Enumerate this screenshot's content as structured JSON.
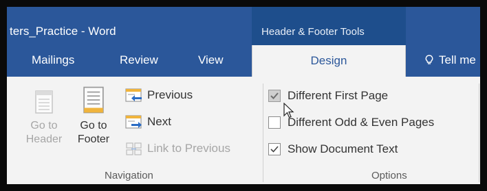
{
  "window": {
    "doc_title": "ters_Practice - Word",
    "context_group": "Header & Footer Tools"
  },
  "tabs": [
    {
      "label": "Mailings",
      "active": false
    },
    {
      "label": "Review",
      "active": false
    },
    {
      "label": "View",
      "active": false
    },
    {
      "label": "Design",
      "active": true
    }
  ],
  "tell_me": {
    "label": "Tell me",
    "icon": "lightbulb-icon"
  },
  "navigation": {
    "go_to_header": {
      "line1": "Go to",
      "line2": "Header",
      "enabled": false
    },
    "go_to_footer": {
      "line1": "Go to",
      "line2": "Footer",
      "enabled": true
    },
    "previous": {
      "label": "Previous",
      "enabled": true
    },
    "next": {
      "label": "Next",
      "enabled": true
    },
    "link_to_previous": {
      "label": "Link to Previous",
      "enabled": false
    },
    "group_label": "Navigation"
  },
  "options": {
    "items": [
      {
        "label": "Different First Page",
        "checked": true
      },
      {
        "label": "Different Odd & Even Pages",
        "checked": false
      },
      {
        "label": "Show Document Text",
        "checked": true
      }
    ],
    "group_label": "Options"
  },
  "colors": {
    "ribbon_blue": "#2b579a",
    "context_blue": "#1e4e8c",
    "arrow_blue": "#2b6cc4",
    "doc_orange": "#f0b43c"
  }
}
